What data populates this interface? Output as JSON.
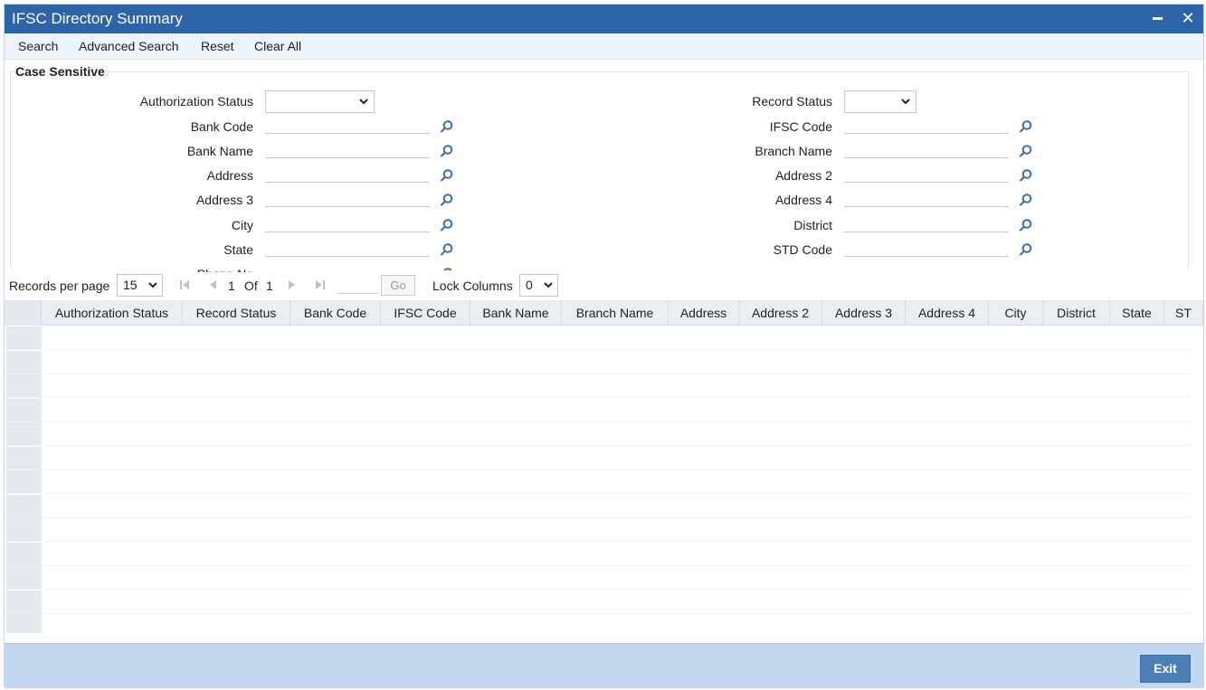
{
  "window": {
    "title": "IFSC Directory Summary"
  },
  "toolbar": {
    "items": [
      "Search",
      "Advanced Search",
      "Reset",
      "Clear All"
    ]
  },
  "criteria": {
    "legend": "Case Sensitive",
    "left_fields": [
      "Authorization Status",
      "Bank Code",
      "Bank Name",
      "Address",
      "Address 3",
      "City",
      "State",
      "Phone No"
    ],
    "right_fields": [
      "Record Status",
      "IFSC Code",
      "Branch Name",
      "Address 2",
      "Address 4",
      "District",
      "STD Code"
    ]
  },
  "pager": {
    "records_label": "Records per page",
    "records_value": "15",
    "page_current": "1",
    "of_label": "Of",
    "page_total": "1",
    "go_label": "Go",
    "lock_label": "Lock Columns",
    "lock_value": "0"
  },
  "grid": {
    "columns": [
      "Authorization Status",
      "Record Status",
      "Bank Code",
      "IFSC Code",
      "Bank Name",
      "Branch Name",
      "Address",
      "Address 2",
      "Address 3",
      "Address 4",
      "City",
      "District",
      "State",
      "ST"
    ],
    "row_count": 13
  },
  "footer": {
    "exit_label": "Exit"
  },
  "icons": {
    "lookup": "search-lookup-icon",
    "minimize": "minimize-icon",
    "close": "close-icon"
  },
  "colors": {
    "titlebar": "#2d64a8",
    "footer": "#c1d8ee",
    "exit_button": "#4b7fb7",
    "lookup_icon": "#3a6fb0"
  }
}
